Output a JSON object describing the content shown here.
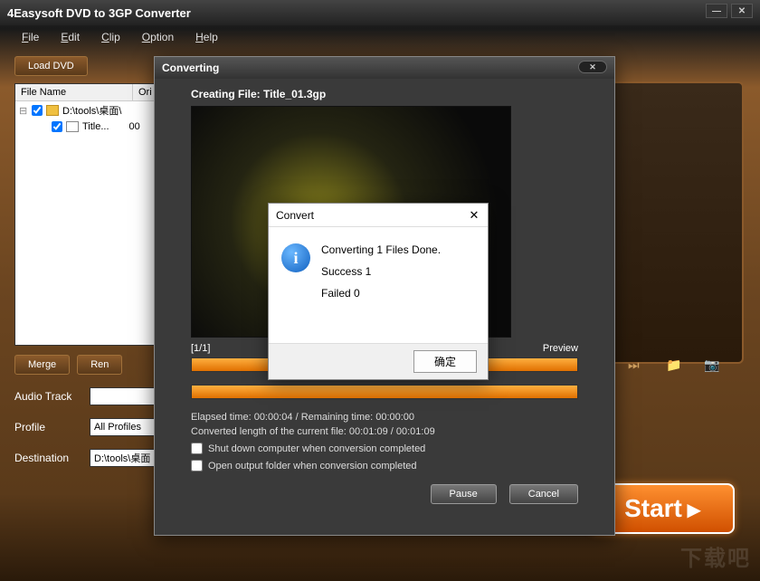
{
  "app": {
    "title": "4Easysoft DVD to 3GP Converter"
  },
  "menu": {
    "file": "File",
    "edit": "Edit",
    "clip": "Clip",
    "option": "Option",
    "help": "Help"
  },
  "toolbar": {
    "load_dvd": "Load DVD"
  },
  "file_list": {
    "col_name": "File Name",
    "col_orig": "Ori",
    "root": "D:\\tools\\桌面\\",
    "child": "Title...",
    "child_val": "00"
  },
  "actions": {
    "merge": "Merge",
    "rename": "Ren"
  },
  "fields": {
    "audio_track_label": "Audio Track",
    "audio_track_value": "",
    "profile_label": "Profile",
    "profile_value": "All Profiles",
    "destination_label": "Destination",
    "destination_value": "D:\\tools\\桌面"
  },
  "start_label": "Start",
  "watermark": "下载吧",
  "dialog": {
    "title": "Converting",
    "creating_prefix": "Creating File: ",
    "creating_file": "Title_01.3gp",
    "progress_counter": "[1/1]",
    "preview_label": "Preview",
    "elapsed": "Elapsed time:  00:00:04 / Remaining time:  00:00:00",
    "converted": "Converted length of the current file:  00:01:09 / 00:01:09",
    "shutdown": "Shut down computer when conversion completed",
    "open_folder": "Open output folder when conversion completed",
    "pause": "Pause",
    "cancel": "Cancel"
  },
  "msgbox": {
    "title": "Convert",
    "line1": "Converting 1 Files Done.",
    "line2": "Success 1",
    "line3": "Failed 0",
    "ok": "确定"
  }
}
